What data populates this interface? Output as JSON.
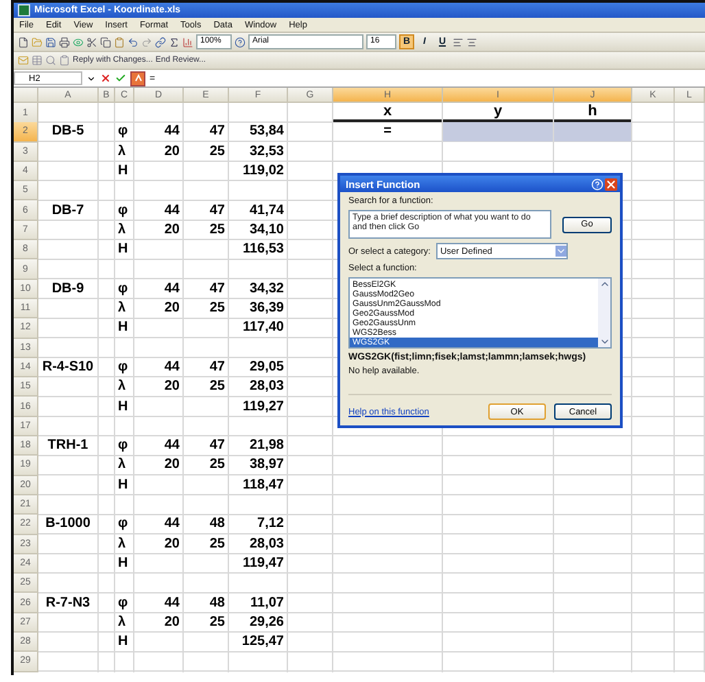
{
  "window": {
    "title": "Microsoft Excel - Koordinate.xls"
  },
  "menu": [
    "File",
    "Edit",
    "View",
    "Insert",
    "Format",
    "Tools",
    "Data",
    "Window",
    "Help"
  ],
  "toolbar": {
    "zoom": "100%",
    "font": "Arial",
    "size": "16",
    "bold": true,
    "format_buttons": [
      "B",
      "I",
      "U"
    ]
  },
  "review_toolbar": {
    "reply": "Reply with Changes...",
    "end": "End Review..."
  },
  "formula_bar": {
    "name_box": "H2",
    "content": "="
  },
  "columns": [
    {
      "label": "A",
      "selected": false
    },
    {
      "label": "B",
      "selected": false
    },
    {
      "label": "C",
      "selected": false
    },
    {
      "label": "D",
      "selected": false
    },
    {
      "label": "E",
      "selected": false
    },
    {
      "label": "F",
      "selected": false
    },
    {
      "label": "G",
      "selected": false
    },
    {
      "label": "H",
      "selected": true
    },
    {
      "label": "I",
      "selected": true
    },
    {
      "label": "J",
      "selected": true
    },
    {
      "label": "K",
      "selected": false
    },
    {
      "label": "L",
      "selected": false
    }
  ],
  "rows": [
    {
      "number": "1",
      "selected": false,
      "cells": {
        "H": {
          "text": "x",
          "selected": false
        },
        "I": {
          "text": "y",
          "selected": false
        },
        "J": {
          "text": "h",
          "selected": false
        }
      }
    },
    {
      "number": "2",
      "selected": true,
      "cells": {
        "A": {
          "text": "DB-5",
          "selected": false
        },
        "C": {
          "text": "φ",
          "selected": false
        },
        "D": {
          "text": "44",
          "selected": false
        },
        "E": {
          "text": "47",
          "selected": false
        },
        "F": {
          "text": "53,84",
          "selected": false
        },
        "H": {
          "text": "=",
          "selected": false
        },
        "I": {
          "selected": true
        },
        "J": {
          "selected": true
        }
      }
    },
    {
      "number": "3",
      "selected": false,
      "cells": {
        "C": {
          "text": "λ",
          "selected": false
        },
        "D": {
          "text": "20",
          "selected": false
        },
        "E": {
          "text": "25",
          "selected": false
        },
        "F": {
          "text": "32,53",
          "selected": false
        }
      }
    },
    {
      "number": "4",
      "selected": false,
      "cells": {
        "C": {
          "text": "H",
          "selected": false
        },
        "F": {
          "text": "119,02",
          "selected": false
        }
      }
    },
    {
      "number": "5",
      "selected": false
    },
    {
      "number": "6",
      "selected": false,
      "cells": {
        "A": {
          "text": "DB-7",
          "selected": false
        },
        "C": {
          "text": "φ",
          "selected": false
        },
        "D": {
          "text": "44",
          "selected": false
        },
        "E": {
          "text": "47",
          "selected": false
        },
        "F": {
          "text": "41,74",
          "selected": false
        }
      }
    },
    {
      "number": "7",
      "selected": false,
      "cells": {
        "C": {
          "text": "λ",
          "selected": false
        },
        "D": {
          "text": "20",
          "selected": false
        },
        "E": {
          "text": "25",
          "selected": false
        },
        "F": {
          "text": "34,10",
          "selected": false
        }
      }
    },
    {
      "number": "8",
      "selected": false,
      "cells": {
        "C": {
          "text": "H",
          "selected": false
        },
        "F": {
          "text": "116,53",
          "selected": false
        }
      }
    },
    {
      "number": "9",
      "selected": false
    },
    {
      "number": "10",
      "selected": false,
      "cells": {
        "A": {
          "text": "DB-9",
          "selected": false
        },
        "C": {
          "text": "φ",
          "selected": false
        },
        "D": {
          "text": "44",
          "selected": false
        },
        "E": {
          "text": "47",
          "selected": false
        },
        "F": {
          "text": "34,32",
          "selected": false
        }
      }
    },
    {
      "number": "11",
      "selected": false,
      "cells": {
        "C": {
          "text": "λ",
          "selected": false
        },
        "D": {
          "text": "20",
          "selected": false
        },
        "E": {
          "text": "25",
          "selected": false
        },
        "F": {
          "text": "36,39",
          "selected": false
        }
      }
    },
    {
      "number": "12",
      "selected": false,
      "cells": {
        "C": {
          "text": "H",
          "selected": false
        },
        "F": {
          "text": "117,40",
          "selected": false
        }
      }
    },
    {
      "number": "13",
      "selected": false
    },
    {
      "number": "14",
      "selected": false,
      "cells": {
        "A": {
          "text": "R-4-S10",
          "selected": false
        },
        "C": {
          "text": "φ",
          "selected": false
        },
        "D": {
          "text": "44",
          "selected": false
        },
        "E": {
          "text": "47",
          "selected": false
        },
        "F": {
          "text": "29,05",
          "selected": false
        }
      }
    },
    {
      "number": "15",
      "selected": false,
      "cells": {
        "C": {
          "text": "λ",
          "selected": false
        },
        "D": {
          "text": "20",
          "selected": false
        },
        "E": {
          "text": "25",
          "selected": false
        },
        "F": {
          "text": "28,03",
          "selected": false
        }
      }
    },
    {
      "number": "16",
      "selected": false,
      "cells": {
        "C": {
          "text": "H",
          "selected": false
        },
        "F": {
          "text": "119,27",
          "selected": false
        }
      }
    },
    {
      "number": "17",
      "selected": false
    },
    {
      "number": "18",
      "selected": false,
      "cells": {
        "A": {
          "text": "TRH-1",
          "selected": false
        },
        "C": {
          "text": "φ",
          "selected": false
        },
        "D": {
          "text": "44",
          "selected": false
        },
        "E": {
          "text": "47",
          "selected": false
        },
        "F": {
          "text": "21,98",
          "selected": false
        }
      }
    },
    {
      "number": "19",
      "selected": false,
      "cells": {
        "C": {
          "text": "λ",
          "selected": false
        },
        "D": {
          "text": "20",
          "selected": false
        },
        "E": {
          "text": "25",
          "selected": false
        },
        "F": {
          "text": "38,97",
          "selected": false
        }
      }
    },
    {
      "number": "20",
      "selected": false,
      "cells": {
        "C": {
          "text": "H",
          "selected": false
        },
        "F": {
          "text": "118,47",
          "selected": false
        }
      }
    },
    {
      "number": "21",
      "selected": false
    },
    {
      "number": "22",
      "selected": false,
      "cells": {
        "A": {
          "text": "B-1000",
          "selected": false
        },
        "C": {
          "text": "φ",
          "selected": false
        },
        "D": {
          "text": "44",
          "selected": false
        },
        "E": {
          "text": "48",
          "selected": false
        },
        "F": {
          "text": "7,12",
          "selected": false
        }
      }
    },
    {
      "number": "23",
      "selected": false,
      "cells": {
        "C": {
          "text": "λ",
          "selected": false
        },
        "D": {
          "text": "20",
          "selected": false
        },
        "E": {
          "text": "25",
          "selected": false
        },
        "F": {
          "text": "28,03",
          "selected": false
        }
      }
    },
    {
      "number": "24",
      "selected": false,
      "cells": {
        "C": {
          "text": "H",
          "selected": false
        },
        "F": {
          "text": "119,47",
          "selected": false
        }
      }
    },
    {
      "number": "25",
      "selected": false
    },
    {
      "number": "26",
      "selected": false,
      "cells": {
        "A": {
          "text": "R-7-N3",
          "selected": false
        },
        "C": {
          "text": "φ",
          "selected": false
        },
        "D": {
          "text": "44",
          "selected": false
        },
        "E": {
          "text": "48",
          "selected": false
        },
        "F": {
          "text": "11,07",
          "selected": false
        }
      }
    },
    {
      "number": "27",
      "selected": false,
      "cells": {
        "C": {
          "text": "λ",
          "selected": false
        },
        "D": {
          "text": "20",
          "selected": false
        },
        "E": {
          "text": "25",
          "selected": false
        },
        "F": {
          "text": "29,26",
          "selected": false
        }
      }
    },
    {
      "number": "28",
      "selected": false,
      "cells": {
        "C": {
          "text": "H",
          "selected": false
        },
        "F": {
          "text": "125,47",
          "selected": false
        }
      }
    },
    {
      "number": "29",
      "selected": false
    }
  ],
  "dialog": {
    "title": "Insert Function",
    "search_label": "Search for a function:",
    "search_placeholder": "Type a brief description of what you want to do and then click Go",
    "go": "Go",
    "category_label": "Or select a category:",
    "category": "User Defined",
    "list_label": "Select a function:",
    "functions": [
      {
        "name": "BessEl2GK",
        "selected": false
      },
      {
        "name": "GaussMod2Geo",
        "selected": false
      },
      {
        "name": "GaussUnm2GaussMod",
        "selected": false
      },
      {
        "name": "Geo2GaussMod",
        "selected": false
      },
      {
        "name": "Geo2GaussUnm",
        "selected": false
      },
      {
        "name": "WGS2Bess",
        "selected": false
      },
      {
        "name": "WGS2GK",
        "selected": true
      }
    ],
    "signature": "WGS2GK(fist;limn;fisek;lamst;lammn;lamsek;hwgs)",
    "help_text": "No help available.",
    "help_link": "Help on this function",
    "ok": "OK",
    "cancel": "Cancel"
  }
}
